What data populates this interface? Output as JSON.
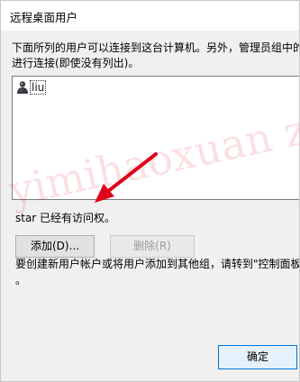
{
  "window": {
    "title": "远程桌面用户"
  },
  "description": {
    "line1": "下面所列的用户可以连接到这台计算机。另外，管理员组中的",
    "line2": "进行连接(即使没有列出)。"
  },
  "user_list": {
    "items": [
      {
        "label": "liu",
        "icon": "user-icon"
      }
    ]
  },
  "access_status": "star 已经有访问权。",
  "buttons": {
    "add_label": "添加(D)...",
    "remove_label": "删除(R)",
    "ok_label": "确定"
  },
  "note": {
    "line1": "要创建新用户帐户或将用户添加到其他组，请转到\"控制面板",
    "line2": "。"
  },
  "overlay": {
    "watermark_text": "yimihaoxuan zhi zhi",
    "watermark_color": "#e0001b",
    "arrow_color": "#e0001b"
  },
  "colors": {
    "dialog_bg": "#f0f0f0",
    "default_button_border": "#0078d7"
  }
}
